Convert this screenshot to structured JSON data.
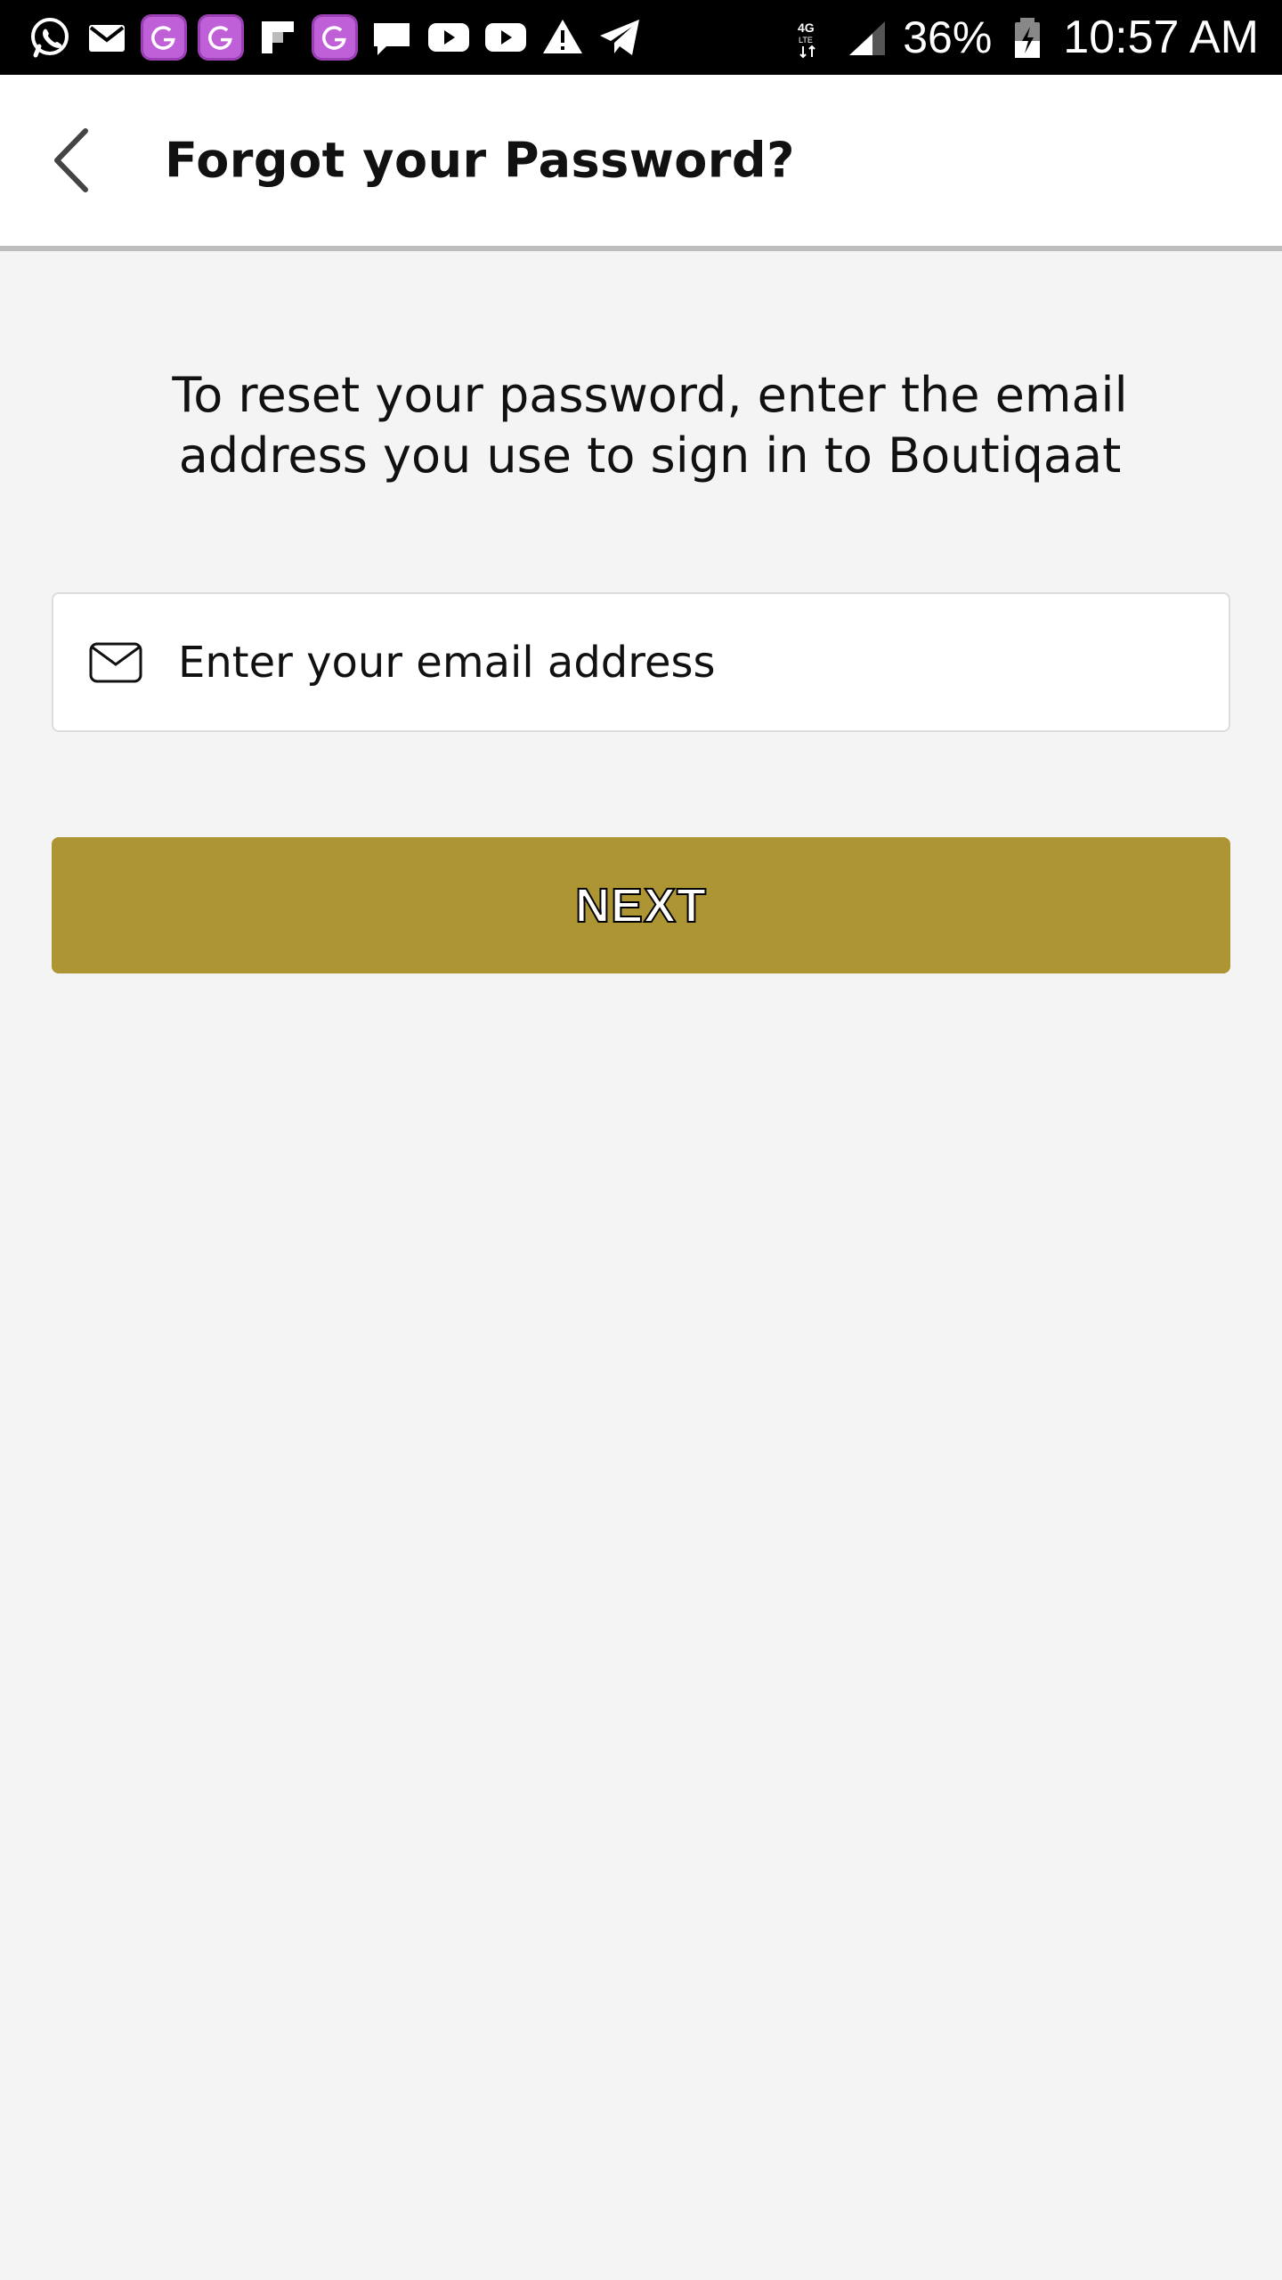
{
  "status_bar": {
    "notification_icons": [
      "whatsapp-icon",
      "email-icon",
      "g-app-icon",
      "g-app-icon",
      "flipboard-icon",
      "g-app-icon",
      "chat-icon",
      "youtube-icon",
      "youtube-icon",
      "warning-icon",
      "telegram-icon"
    ],
    "network": "4G LTE",
    "battery": "36%",
    "time": "10:57 AM"
  },
  "app_bar": {
    "title": "Forgot your Password?"
  },
  "content": {
    "instructions": "To reset your password, enter the email address you use to sign in to Boutiqaat",
    "email_placeholder": "Enter your email address",
    "email_value": "",
    "next_label": "NEXT"
  },
  "colors": {
    "accent": "#ad9534",
    "background": "#f4f4f4",
    "status_bar": "#000000"
  }
}
